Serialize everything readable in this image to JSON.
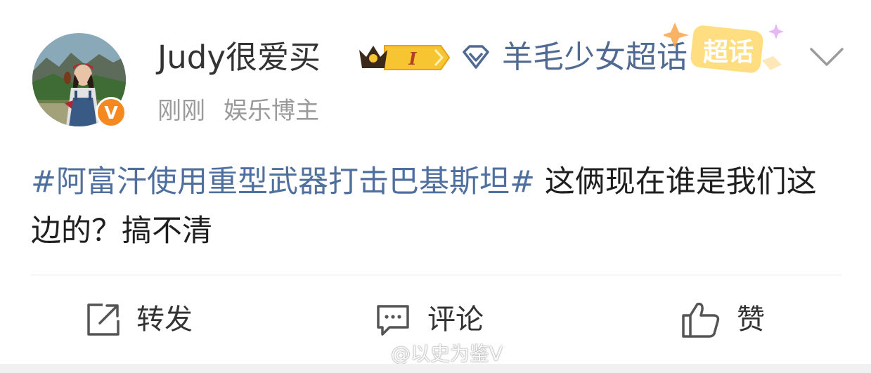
{
  "post": {
    "author": {
      "name": "Judy很爱买",
      "level_badge": "I",
      "verified_mark": "V"
    },
    "supertopic": {
      "name": "羊毛少女超话",
      "tag_label": "超话"
    },
    "meta": {
      "time": "刚刚",
      "source": "娱乐博主"
    },
    "content": {
      "hashtag": "#阿富汗使用重型武器打击巴基斯坦#",
      "text": " 这俩现在谁是我们这边的？搞不清"
    }
  },
  "actions": {
    "repost_label": "转发",
    "comment_label": "评论",
    "like_label": "赞"
  },
  "watermark": {
    "text": "@以史为鉴V"
  },
  "icons": {
    "avatar": "user-avatar-photo",
    "verified": "orange-v-verified-icon",
    "crown": "crown-member-icon",
    "diamond": "diamond-supertopic-icon",
    "chevron": "chevron-down-icon",
    "repost": "share-arrow-icon",
    "comment": "comment-bubble-icon",
    "like": "thumbs-up-icon",
    "weibo": "weibo-logo-icon"
  },
  "colors": {
    "link": "#4f6f9e",
    "supertopic": "#506a92",
    "meta_gray": "#9a9a9a",
    "verified_orange": "#f5891f",
    "text": "#1f1f1f"
  }
}
